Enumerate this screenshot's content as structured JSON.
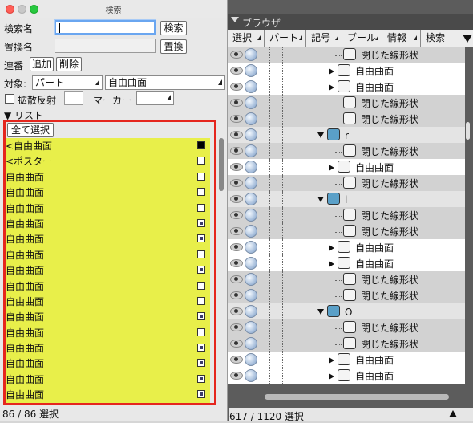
{
  "search_panel": {
    "window_title": "検索",
    "search_name_label": "検索名",
    "search_name_value": "",
    "search_button": "検索",
    "replace_name_label": "置換名",
    "replace_name_value": "",
    "replace_button": "置換",
    "serial_label": "連番",
    "add_button": "追加",
    "delete_button": "削除",
    "target_label": "対象:",
    "target_type_value": "パート",
    "target_kind_value": "自由曲面",
    "diffuse_label": "拡散反射",
    "marker_label": "マーカー",
    "list_label": "▼ リスト",
    "select_all_button": "全て選択",
    "list_items": [
      {
        "label": "<自由曲面",
        "swatch": "black"
      },
      {
        "label": "<ポスター",
        "swatch": "wt"
      },
      {
        "label": "自由曲面",
        "swatch": "wt"
      },
      {
        "label": "自由曲面",
        "swatch": "wt"
      },
      {
        "label": "自由曲面",
        "swatch": "wt"
      },
      {
        "label": "自由曲面",
        "swatch": "dk"
      },
      {
        "label": "自由曲面",
        "swatch": "dk"
      },
      {
        "label": "自由曲面",
        "swatch": "wt"
      },
      {
        "label": "自由曲面",
        "swatch": "dk"
      },
      {
        "label": "自由曲面",
        "swatch": "wt"
      },
      {
        "label": "自由曲面",
        "swatch": "wt"
      },
      {
        "label": "自由曲面",
        "swatch": "dk"
      },
      {
        "label": "自由曲面",
        "swatch": "wt"
      },
      {
        "label": "自由曲面",
        "swatch": "dk"
      },
      {
        "label": "自由曲面",
        "swatch": "dk"
      },
      {
        "label": "自由曲面",
        "swatch": "dk"
      },
      {
        "label": "自由曲面",
        "swatch": "dk"
      }
    ],
    "status": "86 / 86 選択"
  },
  "browser": {
    "title": "ブラウザ",
    "tabs": [
      "選択",
      "パート",
      "記号",
      "ブール",
      "情報",
      "検索"
    ],
    "rows": [
      {
        "indent": 134,
        "kind": "closed",
        "label": "閉じた線形状",
        "style": "alt"
      },
      {
        "indent": 126,
        "kind": "surface",
        "label": "自由曲面",
        "style": "white"
      },
      {
        "indent": 126,
        "kind": "surface",
        "label": "自由曲面",
        "style": "white"
      },
      {
        "indent": 134,
        "kind": "closed",
        "label": "閉じた線形状",
        "style": "alt"
      },
      {
        "indent": 134,
        "kind": "closed",
        "label": "閉じた線形状",
        "style": "alt"
      },
      {
        "indent": 112,
        "kind": "folder",
        "label": "r",
        "style": "grey"
      },
      {
        "indent": 134,
        "kind": "closed",
        "label": "閉じた線形状",
        "style": "alt"
      },
      {
        "indent": 126,
        "kind": "surface",
        "label": "自由曲面",
        "style": "white"
      },
      {
        "indent": 134,
        "kind": "closed",
        "label": "閉じた線形状",
        "style": "alt"
      },
      {
        "indent": 112,
        "kind": "folder",
        "label": "i",
        "style": "grey"
      },
      {
        "indent": 134,
        "kind": "closed",
        "label": "閉じた線形状",
        "style": "alt"
      },
      {
        "indent": 134,
        "kind": "closed",
        "label": "閉じた線形状",
        "style": "alt"
      },
      {
        "indent": 126,
        "kind": "surface",
        "label": "自由曲面",
        "style": "white"
      },
      {
        "indent": 126,
        "kind": "surface",
        "label": "自由曲面",
        "style": "white"
      },
      {
        "indent": 134,
        "kind": "closed",
        "label": "閉じた線形状",
        "style": "alt"
      },
      {
        "indent": 134,
        "kind": "closed",
        "label": "閉じた線形状",
        "style": "alt"
      },
      {
        "indent": 112,
        "kind": "folder",
        "label": "O",
        "style": "grey"
      },
      {
        "indent": 134,
        "kind": "closed",
        "label": "閉じた線形状",
        "style": "alt"
      },
      {
        "indent": 134,
        "kind": "closed",
        "label": "閉じた線形状",
        "style": "alt"
      },
      {
        "indent": 126,
        "kind": "surface",
        "label": "自由曲面",
        "style": "white"
      },
      {
        "indent": 126,
        "kind": "surface",
        "label": "自由曲面",
        "style": "white"
      }
    ],
    "status": "617 / 1120 選択"
  }
}
